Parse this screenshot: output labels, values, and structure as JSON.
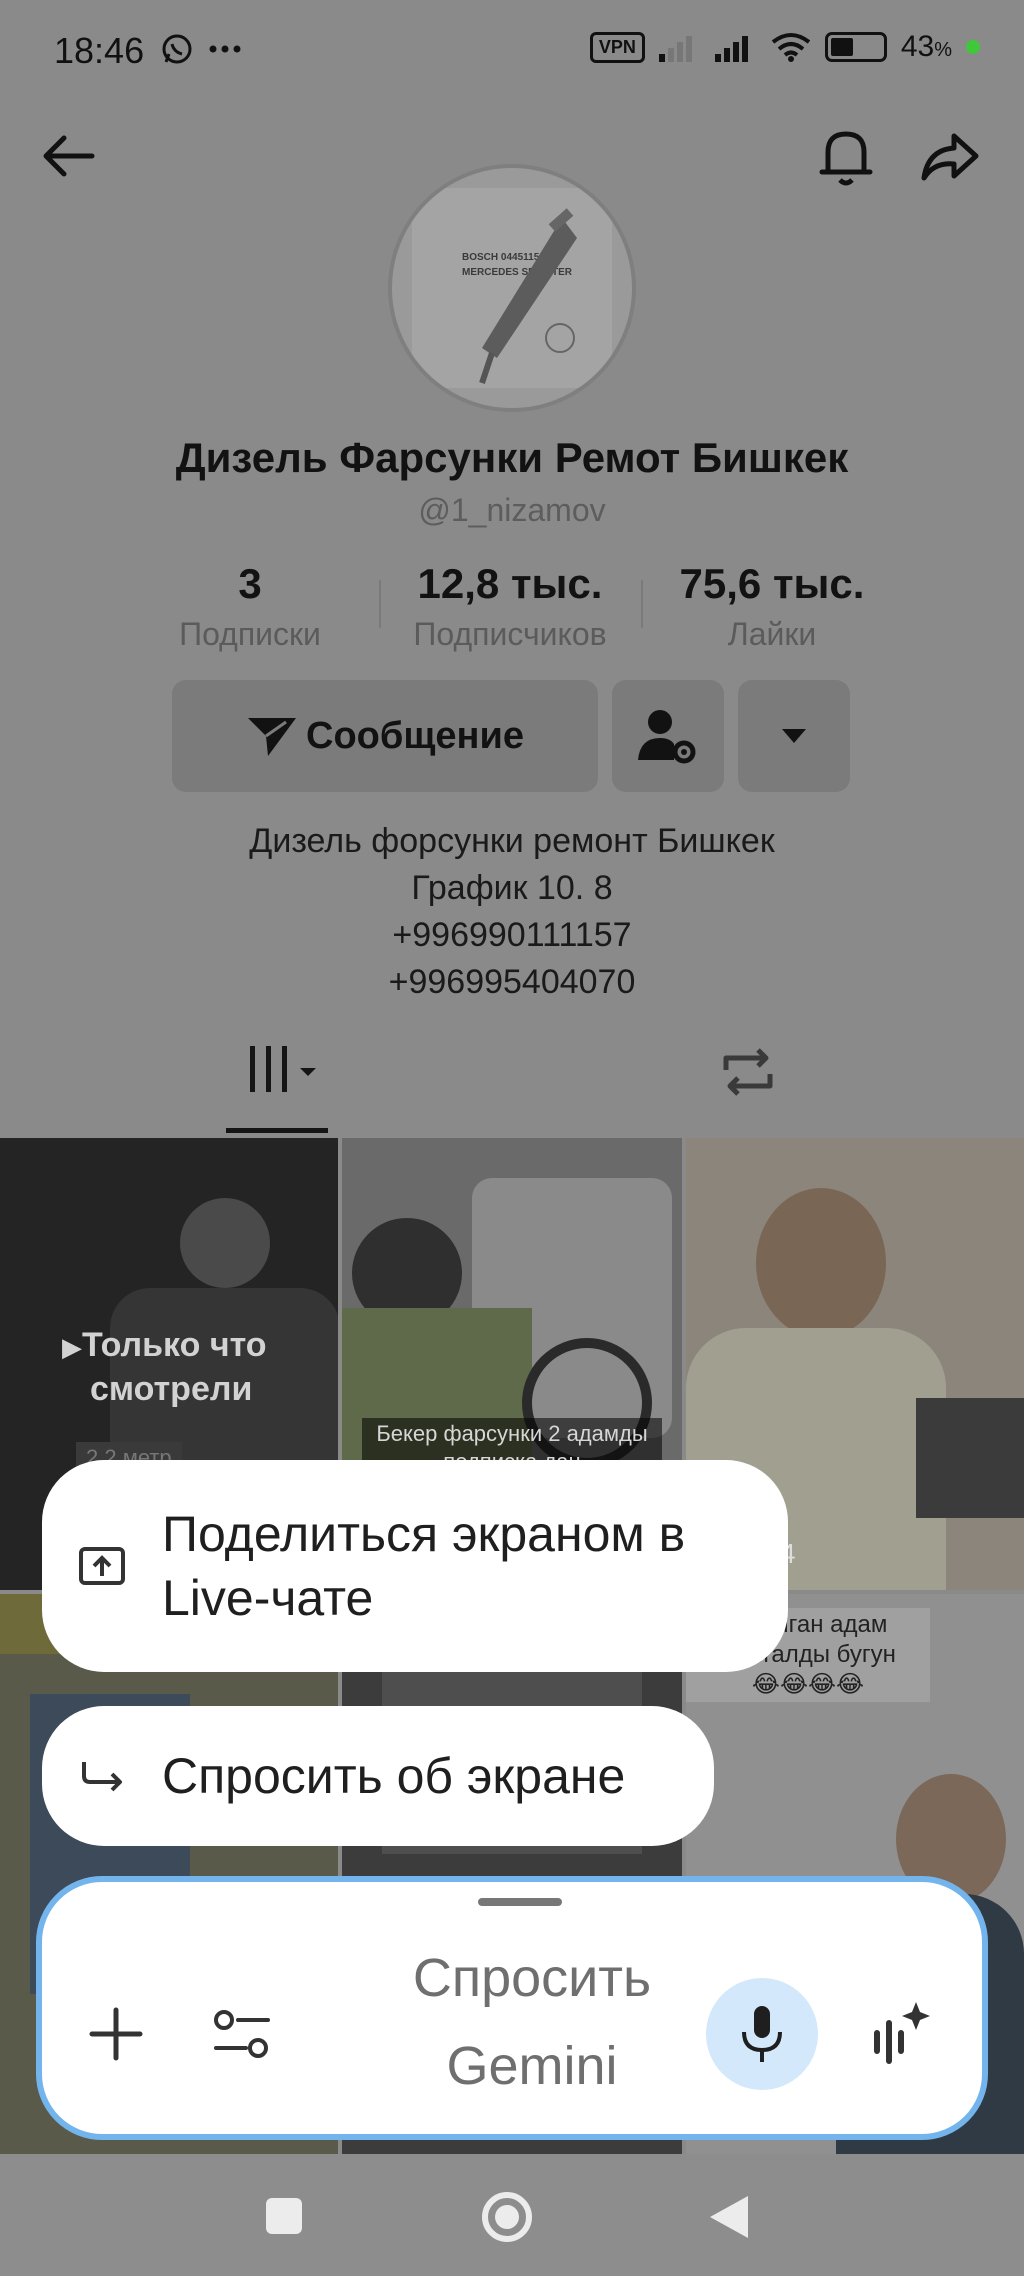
{
  "status_bar": {
    "time": "18:46",
    "vpn_label": "VPN",
    "battery": "43",
    "battery_unit": "%",
    "icons": [
      "whatsapp-icon",
      "more-dots-icon",
      "signal-icon",
      "signal-icon",
      "wifi-icon",
      "battery-icon"
    ]
  },
  "header": {
    "back_icon": "arrow-left-icon",
    "bell_icon": "bell-icon",
    "share_icon": "share-icon"
  },
  "profile": {
    "avatar_text_1": "BOSCH 0445115069",
    "avatar_text_2": "MERCEDES SPRINTER",
    "name": "Дизель Фарсунки Ремот Бишкек",
    "handle": "@1_nizamov",
    "stats": [
      {
        "value": "3",
        "label": "Подписки"
      },
      {
        "value": "12,8 тыс.",
        "label": "Подписчиков"
      },
      {
        "value": "75,6 тыс.",
        "label": "Лайки"
      }
    ],
    "message_button": "Сообщение",
    "bio": [
      "Дизель форсунки ремонт Бишкек",
      "График 10. 8",
      "+996990111157",
      "+996995404070"
    ]
  },
  "tabs": {
    "videos_icon": "grid-bars-icon",
    "reposts_icon": "repost-icon"
  },
  "grid": {
    "tile1_caption_1": "Только что",
    "tile1_caption_2": "смотрели",
    "tile1_sub": "2,2 метр",
    "tile2_caption_1": "Бекер фарсунки 2 адамды",
    "tile2_caption_2": "подписка дан",
    "tile3_count": "4",
    "tile6_caption_1": "уб алган адам",
    "tile6_caption_2": "чыкталды бугун",
    "tile6_emoji": "😂😂😂😂"
  },
  "overlay": {
    "share_screen_line1": "Поделиться экраном в",
    "share_screen_line2": "Live-чате",
    "ask_screen": "Спросить об экране"
  },
  "gemini": {
    "placeholder_1": "Спросить",
    "placeholder_2": "Gemini"
  },
  "colors": {
    "accent_border": "#73b4ec",
    "mic_bg": "#d3e8fb",
    "dim": "#8a8a8a"
  }
}
